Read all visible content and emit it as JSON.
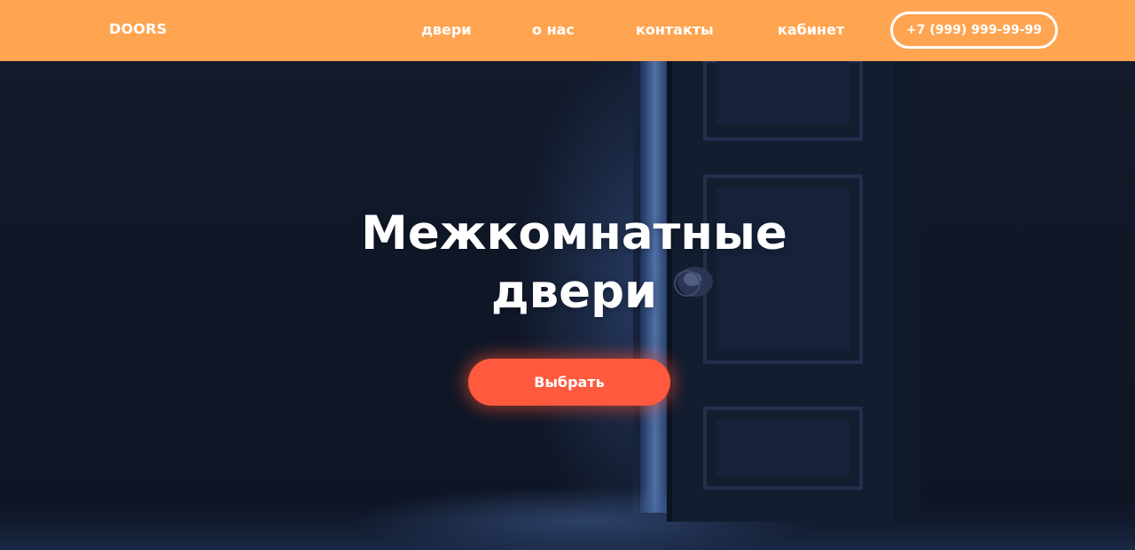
{
  "header": {
    "logo": "DOORS",
    "nav": [
      {
        "label": "двери"
      },
      {
        "label": "о нас"
      },
      {
        "label": "контакты"
      },
      {
        "label": "кабинет"
      }
    ],
    "phone": "+7 (999) 999-99-99"
  },
  "hero": {
    "title_line1": "Межкомнатные",
    "title_line2": "двери",
    "cta_label": "Выбрать"
  },
  "colors": {
    "header_bg": "#ffa552",
    "hero_bg": "#0f1626",
    "cta_bg": "#ff5a3d",
    "text": "#ffffff"
  }
}
